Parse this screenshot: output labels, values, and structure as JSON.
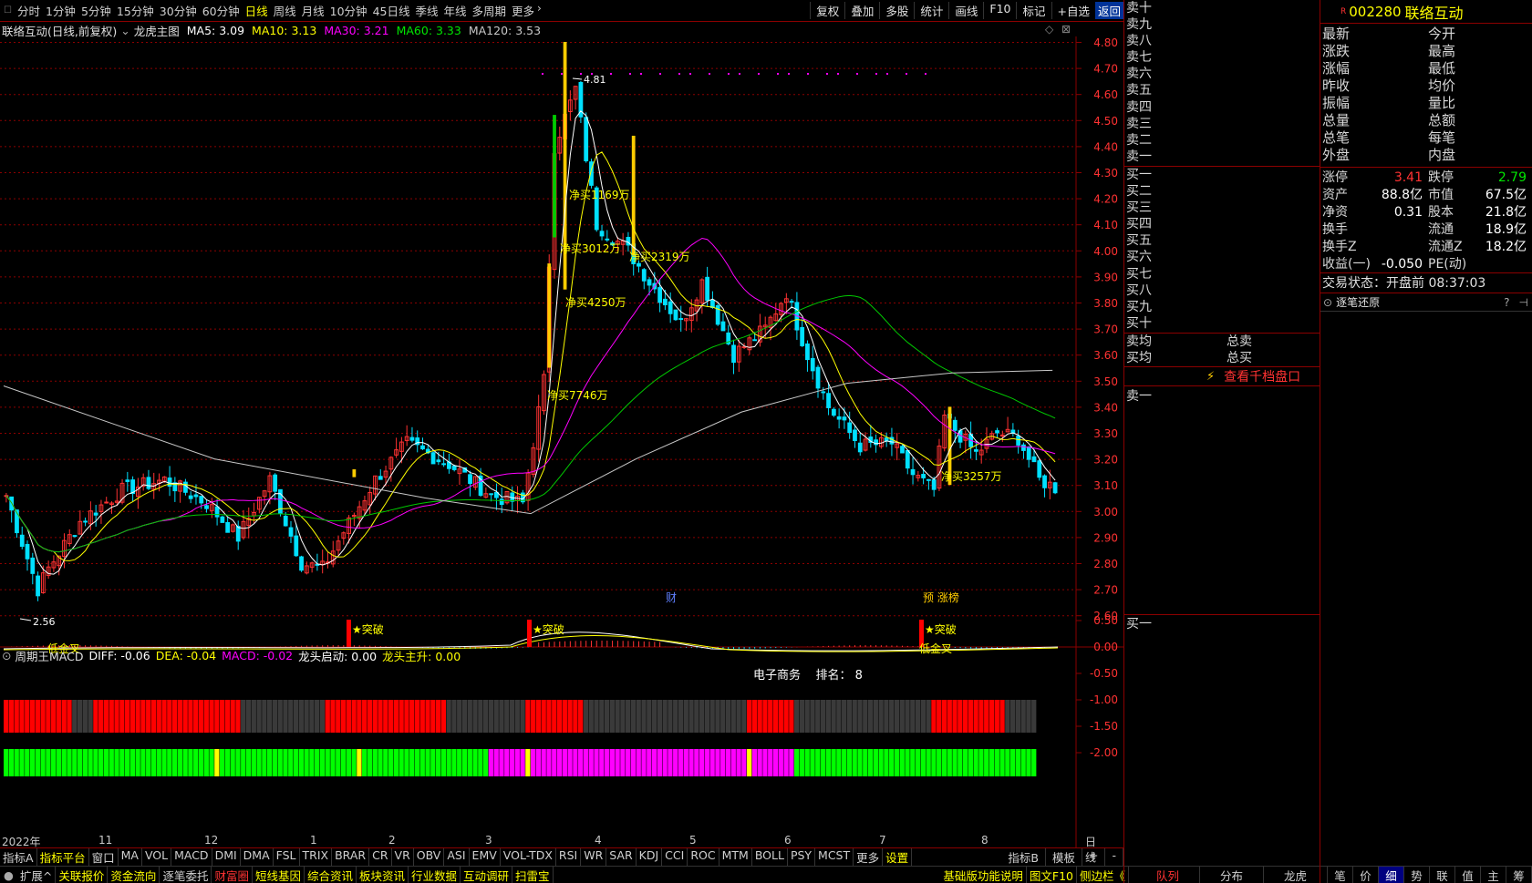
{
  "toolbar": {
    "periods": [
      "分时",
      "1分钟",
      "5分钟",
      "15分钟",
      "30分钟",
      "60分钟",
      "日线",
      "周线",
      "月线",
      "10分钟",
      "45日线",
      "季线",
      "年线",
      "多周期",
      "更多"
    ],
    "active": "日线",
    "right": [
      "复权",
      "叠加",
      "多股",
      "统计",
      "画线",
      "F10",
      "标记",
      "+自选"
    ],
    "back": "返回"
  },
  "info": {
    "title": "联络互动(日线,前复权)",
    "indicator": "龙虎主图",
    "ma5": "MA5: 3.09",
    "ma10": "MA10: 3.13",
    "ma30": "MA30: 3.21",
    "ma60": "MA60: 3.33",
    "ma120": "MA120: 3.53"
  },
  "colors": {
    "up": "#ff3232",
    "down": "#00e0ff",
    "ma5": "#ffffff",
    "ma10": "#ffff00",
    "ma30": "#ff00ff",
    "ma60": "#00c800",
    "ma120": "#c8c8c8",
    "grid": "#8c0000"
  },
  "chart_data": {
    "type": "candlestick",
    "title": "龙虎主图",
    "ylim": [
      2.56,
      4.81
    ],
    "yticks": [
      "4.80",
      "4.70",
      "4.60",
      "4.50",
      "4.40",
      "4.30",
      "4.20",
      "4.10",
      "4.00",
      "3.90",
      "3.80",
      "3.70",
      "3.60",
      "3.50",
      "3.40",
      "3.30",
      "3.20",
      "3.10",
      "3.00",
      "2.90",
      "2.80",
      "2.70",
      "2.60"
    ],
    "high_label": "4.81",
    "low_label": "2.56",
    "annotations": [
      "净买7746万",
      "净买4250万",
      "净买1169万",
      "净买3012万",
      "净买2319万",
      "净买3257万"
    ],
    "markers": [
      "财",
      "预 涨榜"
    ],
    "months": [
      "2022年",
      "11",
      "12",
      "1",
      "2",
      "3",
      "4",
      "5",
      "6",
      "7",
      "8"
    ],
    "period": "日线"
  },
  "macd": {
    "title": "周期王MACD",
    "diff": "DIFF: -0.06",
    "dea": "DEA: -0.04",
    "macd": "MACD: -0.02",
    "start": "龙头启动: 0.00",
    "rise": "龙头主升: 0.00",
    "yticks": [
      "0.50",
      "0.00",
      "-0.50",
      "-1.00",
      "-1.50",
      "-2.00"
    ],
    "labels": [
      "★突破",
      "★突破",
      "★突破",
      "低金叉",
      "低金叉"
    ],
    "sector": "电子商务",
    "rank": "排名： 8"
  },
  "indicator_tabs": [
    "指标A",
    "指标平台",
    "窗口",
    "MA",
    "VOL",
    "MACD",
    "DMI",
    "DMA",
    "FSL",
    "TRIX",
    "BRAR",
    "CR",
    "VR",
    "OBV",
    "ASI",
    "EMV",
    "VOL-TDX",
    "RSI",
    "WR",
    "SAR",
    "KDJ",
    "CCI",
    "ROC",
    "MTM",
    "BOLL",
    "PSY",
    "MCST",
    "更多",
    "设置"
  ],
  "tabs_right": [
    "指标B",
    "模板",
    "+",
    "-"
  ],
  "info_tabs": [
    "扩展^",
    "关联报价",
    "资金流向",
    "逐笔委托",
    "财富圈",
    "短线基因",
    "综合资讯",
    "板块资讯",
    "行业数据",
    "互动调研",
    "扫雷宝"
  ],
  "info_tabs_right": [
    "基础版功能说明",
    "图文F10",
    "侧边栏《"
  ],
  "bottom_right_tabs": [
    "队列",
    "分布",
    "龙虎",
    "笔",
    "价",
    "细",
    "势",
    "联",
    "值",
    "主",
    "筹"
  ],
  "orderbook": {
    "sell": [
      "卖十",
      "卖九",
      "卖八",
      "卖七",
      "卖六",
      "卖五",
      "卖四",
      "卖三",
      "卖二",
      "卖一"
    ],
    "buy": [
      "买一",
      "买二",
      "买三",
      "买四",
      "买五",
      "买六",
      "买七",
      "买八",
      "买九",
      "买十"
    ],
    "avg_sell": "卖均",
    "avg_buy": "买均",
    "total_sell": "总卖",
    "total_buy": "总买",
    "link": "查看千档盘口",
    "queue_sell": "卖一",
    "queue_buy": "买一"
  },
  "stock": {
    "code": "002280",
    "name": "联络互动",
    "flag": "R"
  },
  "quote": [
    [
      "最新",
      "今开"
    ],
    [
      "涨跌",
      "最高"
    ],
    [
      "涨幅",
      "最低"
    ],
    [
      "昨收",
      "均价"
    ],
    [
      "振幅",
      "量比"
    ],
    [
      "总量",
      "总额"
    ],
    [
      "总笔",
      "每笔"
    ],
    [
      "外盘",
      "内盘"
    ]
  ],
  "fund": [
    [
      "涨停",
      "3.41",
      "跌停",
      "2.79"
    ],
    [
      "资产",
      "88.8亿",
      "市值",
      "67.5亿"
    ],
    [
      "净资",
      "0.31",
      "股本",
      "21.8亿"
    ],
    [
      "换手",
      "",
      "流通",
      "18.9亿"
    ],
    [
      "换手Z",
      "",
      "流通Z",
      "18.2亿"
    ],
    [
      "收益(一)",
      "-0.050",
      "PE(动)",
      ""
    ]
  ],
  "trade_status": "交易状态：开盘前 08:37:03",
  "tick_title": "逐笔还原"
}
